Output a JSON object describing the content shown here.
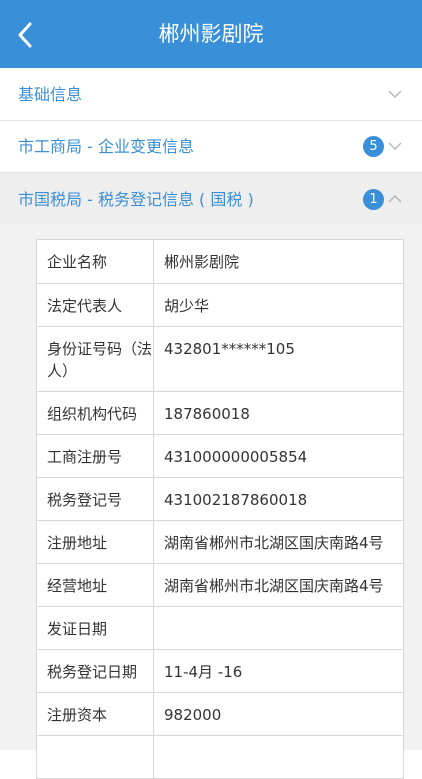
{
  "header": {
    "title": "郴州影剧院"
  },
  "sections": [
    {
      "label": "基础信息",
      "badge": null,
      "expanded": false
    },
    {
      "label": "市工商局 - 企业变更信息",
      "badge": "5",
      "expanded": false
    },
    {
      "label": "市国税局 - 税务登记信息 ( 国税 )",
      "badge": "1",
      "expanded": true
    }
  ],
  "details": [
    {
      "key": "企业名称",
      "value": "郴州影剧院"
    },
    {
      "key": "法定代表人",
      "value": "胡少华"
    },
    {
      "key": "身份证号码（法人）",
      "value": "432801******105"
    },
    {
      "key": "组织机构代码",
      "value": "187860018"
    },
    {
      "key": "工商注册号",
      "value": "431000000005854"
    },
    {
      "key": "税务登记号",
      "value": "431002187860018"
    },
    {
      "key": "注册地址",
      "value": "湖南省郴州市北湖区国庆南路4号"
    },
    {
      "key": "经营地址",
      "value": "湖南省郴州市北湖区国庆南路4号"
    },
    {
      "key": "发证日期",
      "value": ""
    },
    {
      "key": "税务登记日期",
      "value": "11-4月 -16"
    },
    {
      "key": "注册资本",
      "value": "982000"
    },
    {
      "key": "",
      "value": ""
    }
  ],
  "colors": {
    "accent": "#3a8fd9",
    "active_bg": "#eeeeee",
    "content_bg": "#f2f2f2"
  }
}
